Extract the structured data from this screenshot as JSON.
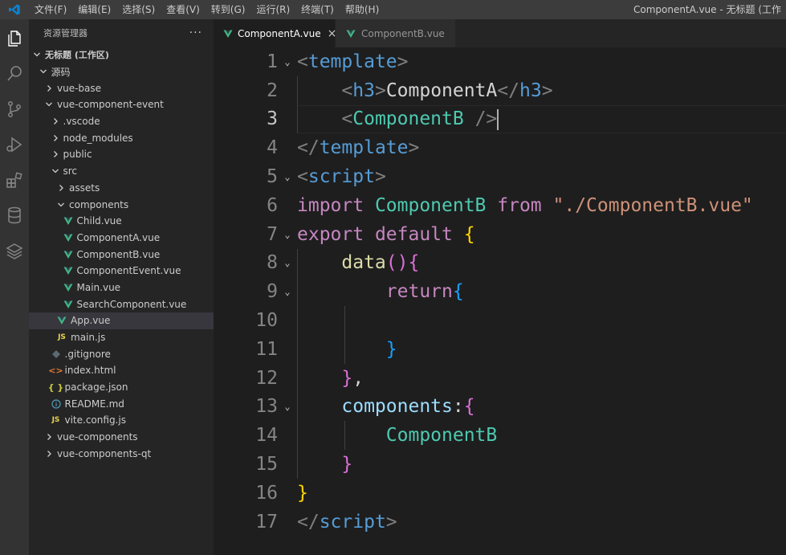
{
  "titlebar": {
    "menu": [
      "文件(F)",
      "编辑(E)",
      "选择(S)",
      "查看(V)",
      "转到(G)",
      "运行(R)",
      "终端(T)",
      "帮助(H)"
    ],
    "window_title": "ComponentA.vue - 无标题 (工作"
  },
  "activity_bar": {
    "icons": [
      "explorer-icon",
      "search-icon",
      "source-control-icon",
      "run-debug-icon",
      "extensions-icon",
      "database-icon",
      "layers-icon"
    ]
  },
  "sidebar": {
    "title": "资源管理器",
    "more": "···",
    "workspace": "无标题 (工作区)",
    "items": [
      {
        "label": "源码",
        "depth": 1,
        "kind": "folder-open"
      },
      {
        "label": "vue-base",
        "depth": 2,
        "kind": "folder"
      },
      {
        "label": "vue-component-event",
        "depth": 2,
        "kind": "folder-open"
      },
      {
        "label": ".vscode",
        "depth": 3,
        "kind": "folder"
      },
      {
        "label": "node_modules",
        "depth": 3,
        "kind": "folder"
      },
      {
        "label": "public",
        "depth": 3,
        "kind": "folder"
      },
      {
        "label": "src",
        "depth": 3,
        "kind": "folder-open"
      },
      {
        "label": "assets",
        "depth": 4,
        "kind": "folder"
      },
      {
        "label": "components",
        "depth": 4,
        "kind": "folder-open"
      },
      {
        "label": "Child.vue",
        "depth": 5,
        "kind": "vue"
      },
      {
        "label": "ComponentA.vue",
        "depth": 5,
        "kind": "vue"
      },
      {
        "label": "ComponentB.vue",
        "depth": 5,
        "kind": "vue"
      },
      {
        "label": "ComponentEvent.vue",
        "depth": 5,
        "kind": "vue"
      },
      {
        "label": "Main.vue",
        "depth": 5,
        "kind": "vue"
      },
      {
        "label": "SearchComponent.vue",
        "depth": 5,
        "kind": "vue"
      },
      {
        "label": "App.vue",
        "depth": 4,
        "kind": "vue",
        "selected": true
      },
      {
        "label": "main.js",
        "depth": 4,
        "kind": "js"
      },
      {
        "label": ".gitignore",
        "depth": 3,
        "kind": "git"
      },
      {
        "label": "index.html",
        "depth": 3,
        "kind": "html"
      },
      {
        "label": "package.json",
        "depth": 3,
        "kind": "json"
      },
      {
        "label": "README.md",
        "depth": 3,
        "kind": "info"
      },
      {
        "label": "vite.config.js",
        "depth": 3,
        "kind": "js"
      },
      {
        "label": "vue-components",
        "depth": 2,
        "kind": "folder"
      },
      {
        "label": "vue-components-qt",
        "depth": 2,
        "kind": "folder"
      }
    ],
    "icon_text": {
      "js": "JS",
      "json": "{ }",
      "html": "<>"
    }
  },
  "tabs": [
    {
      "label": "ComponentA.vue",
      "active": true,
      "close": "×"
    },
    {
      "label": "ComponentB.vue",
      "active": false
    }
  ],
  "editor": {
    "current_line": 3,
    "lines": [
      {
        "n": "1",
        "fold": true,
        "tokens": [
          [
            "<",
            "t-punct"
          ],
          [
            "template",
            "t-tag"
          ],
          [
            ">",
            "t-punct"
          ]
        ]
      },
      {
        "n": "2",
        "tokens": [
          [
            "    ",
            ""
          ],
          [
            "<",
            "t-punct"
          ],
          [
            "h3",
            "t-tag"
          ],
          [
            ">",
            "t-punct"
          ],
          [
            "ComponentA",
            "t-white"
          ],
          [
            "</",
            "t-punct"
          ],
          [
            "h3",
            "t-tag"
          ],
          [
            ">",
            "t-punct"
          ]
        ]
      },
      {
        "n": "3",
        "caret": true,
        "tokens": [
          [
            "    ",
            ""
          ],
          [
            "<",
            "t-punct"
          ],
          [
            "ComponentB",
            "t-comp"
          ],
          [
            " />",
            "t-punct"
          ]
        ]
      },
      {
        "n": "4",
        "tokens": [
          [
            "</",
            "t-punct"
          ],
          [
            "template",
            "t-tag"
          ],
          [
            ">",
            "t-punct"
          ]
        ]
      },
      {
        "n": "5",
        "fold": true,
        "tokens": [
          [
            "<",
            "t-punct"
          ],
          [
            "script",
            "t-tag"
          ],
          [
            ">",
            "t-punct"
          ]
        ]
      },
      {
        "n": "6",
        "tokens": [
          [
            "import ",
            "t-kw"
          ],
          [
            "ComponentB ",
            "t-comp"
          ],
          [
            "from ",
            "t-kw"
          ],
          [
            "\"./ComponentB.vue\"",
            "t-str"
          ]
        ]
      },
      {
        "n": "7",
        "fold": true,
        "tokens": [
          [
            "export ",
            "t-kw"
          ],
          [
            "default ",
            "t-kw"
          ],
          [
            "{",
            "t-b1"
          ]
        ]
      },
      {
        "n": "8",
        "fold": true,
        "tokens": [
          [
            "    ",
            ""
          ],
          [
            "data",
            "t-fn"
          ],
          [
            "()",
            "t-b2"
          ],
          [
            "{",
            "t-b2"
          ]
        ]
      },
      {
        "n": "9",
        "fold": true,
        "tokens": [
          [
            "        ",
            ""
          ],
          [
            "return",
            "t-kw"
          ],
          [
            "{",
            "t-b3"
          ]
        ]
      },
      {
        "n": "10",
        "tokens": []
      },
      {
        "n": "11",
        "tokens": [
          [
            "        ",
            ""
          ],
          [
            "}",
            "t-b3"
          ]
        ]
      },
      {
        "n": "12",
        "tokens": [
          [
            "    ",
            ""
          ],
          [
            "}",
            "t-b2"
          ],
          [
            ",",
            "t-white"
          ]
        ]
      },
      {
        "n": "13",
        "fold": true,
        "tokens": [
          [
            "    ",
            ""
          ],
          [
            "components",
            "t-var"
          ],
          [
            ":",
            "t-white"
          ],
          [
            "{",
            "t-b2"
          ]
        ]
      },
      {
        "n": "14",
        "tokens": [
          [
            "        ",
            ""
          ],
          [
            "ComponentB",
            "t-comp"
          ]
        ]
      },
      {
        "n": "15",
        "tokens": [
          [
            "    ",
            ""
          ],
          [
            "}",
            "t-b2"
          ]
        ]
      },
      {
        "n": "16",
        "tokens": [
          [
            "}",
            "t-b1"
          ]
        ]
      },
      {
        "n": "17",
        "tokens": [
          [
            "</",
            "t-punct"
          ],
          [
            "script",
            "t-tag"
          ],
          [
            ">",
            "t-punct"
          ]
        ]
      }
    ]
  }
}
